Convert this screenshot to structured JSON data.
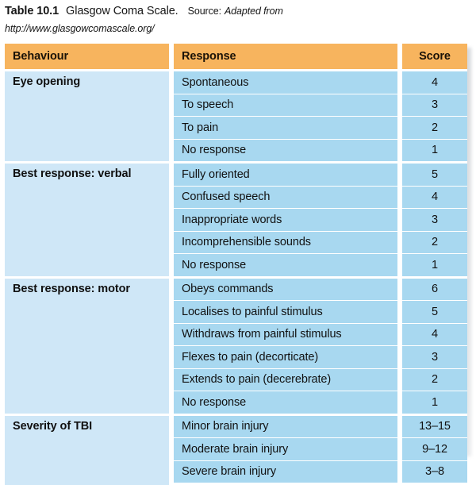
{
  "caption": {
    "table_number": "Table 10.1",
    "title": "Glasgow Coma Scale.",
    "source_label": "Source:",
    "source_value": "Adapted from",
    "source_url": "http://www.glasgowcomascale.org/"
  },
  "colors": {
    "header_background": "#f7b45e",
    "behaviour_cell_background": "#cfe7f7",
    "data_cell_background": "#a8d8f0",
    "page_background": "#ffffff",
    "text": "#111111"
  },
  "table": {
    "headers": {
      "behaviour": "Behaviour",
      "response": "Response",
      "score": "Score"
    },
    "sections": [
      {
        "behaviour": "Eye opening",
        "rows": [
          {
            "response": "Spontaneous",
            "score": "4"
          },
          {
            "response": "To speech",
            "score": "3"
          },
          {
            "response": "To pain",
            "score": "2"
          },
          {
            "response": "No response",
            "score": "1"
          }
        ]
      },
      {
        "behaviour": "Best response: verbal",
        "rows": [
          {
            "response": "Fully oriented",
            "score": "5"
          },
          {
            "response": "Confused speech",
            "score": "4"
          },
          {
            "response": "Inappropriate words",
            "score": "3"
          },
          {
            "response": "Incomprehensible sounds",
            "score": "2"
          },
          {
            "response": "No response",
            "score": "1"
          }
        ]
      },
      {
        "behaviour": "Best response: motor",
        "rows": [
          {
            "response": "Obeys commands",
            "score": "6"
          },
          {
            "response": "Localises to painful stimulus",
            "score": "5"
          },
          {
            "response": "Withdraws from painful stimulus",
            "score": "4"
          },
          {
            "response": "Flexes to pain (decorticate)",
            "score": "3"
          },
          {
            "response": "Extends to pain (decerebrate)",
            "score": "2"
          },
          {
            "response": "No response",
            "score": "1"
          }
        ]
      },
      {
        "behaviour": "Severity of TBI",
        "rows": [
          {
            "response": "Minor brain injury",
            "score": "13–15"
          },
          {
            "response": "Moderate brain injury",
            "score": "9–12"
          },
          {
            "response": "Severe brain injury",
            "score": "3–8"
          }
        ]
      }
    ]
  }
}
